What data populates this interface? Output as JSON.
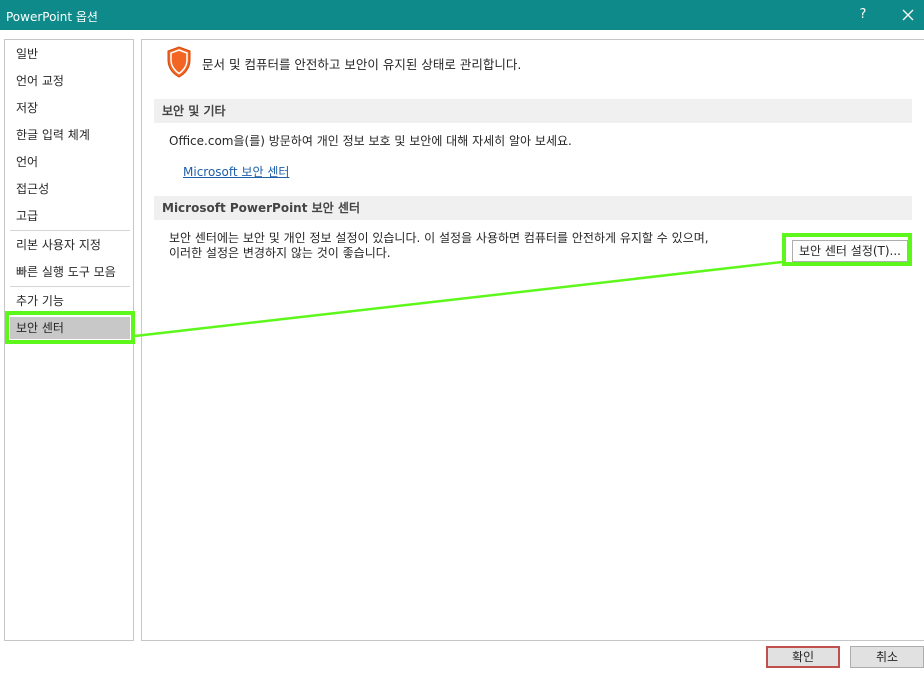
{
  "window": {
    "title": "PowerPoint 옵션",
    "help_label": "?",
    "title_bar_color": "#0e8a8a"
  },
  "sidebar": {
    "items": [
      {
        "label": "일반"
      },
      {
        "label": "언어 교정"
      },
      {
        "label": "저장"
      },
      {
        "label": "한글 입력 체계"
      },
      {
        "label": "언어"
      },
      {
        "label": "접근성"
      },
      {
        "label": "고급"
      },
      {
        "label": "리본 사용자 지정"
      },
      {
        "label": "빠른 실행 도구 모음"
      },
      {
        "label": "추가 기능"
      },
      {
        "label": "보안 센터",
        "selected": true
      }
    ]
  },
  "main": {
    "intro_text": "문서 및 컴퓨터를 안전하고 보안이 유지된 상태로 관리합니다.",
    "section1": {
      "header": "보안 및 기타",
      "description": "Office.com을(를) 방문하여 개인 정보 보호 및 보안에 대해 자세히 알아 보세요.",
      "link": "Microsoft 보안 센터"
    },
    "section2": {
      "header": "Microsoft PowerPoint 보안 센터",
      "description_line1": "보안 센터에는 보안 및 개인 정보 설정이 있습니다. 이 설정을 사용하면 컴퓨터를 안전하게 유지할 수 있으며,",
      "description_line2": "이러한 설정은 변경하지 않는 것이 좋습니다.",
      "button_label": "보안 센터 설정(T)..."
    }
  },
  "footer": {
    "ok_label": "확인",
    "cancel_label": "취소"
  },
  "highlight_color": "#5ef71b",
  "shield_icon": "shield-icon"
}
